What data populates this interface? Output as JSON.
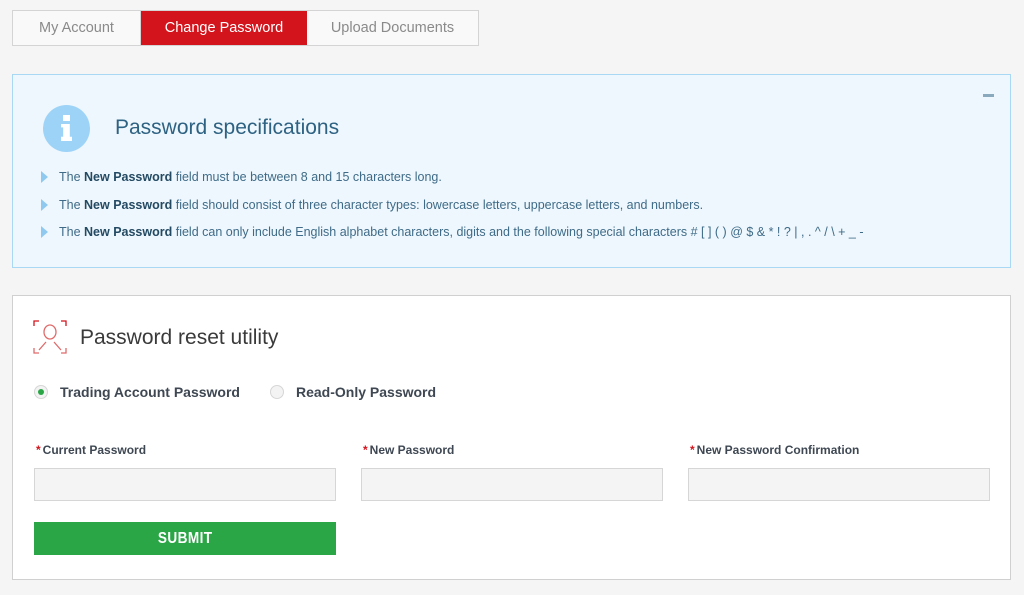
{
  "tabs": [
    {
      "label": "My Account",
      "active": false
    },
    {
      "label": "Change Password",
      "active": true
    },
    {
      "label": "Upload Documents",
      "active": false
    }
  ],
  "spec": {
    "icon": "info-icon",
    "title": "Password specifications",
    "collapse_icon": "minus-icon",
    "items": [
      {
        "prefix": "The ",
        "bold": "New Password",
        "suffix": " field must be between 8 and 15 characters long."
      },
      {
        "prefix": "The ",
        "bold": "New Password",
        "suffix": " field should consist of three character types: lowercase letters, uppercase letters, and numbers."
      },
      {
        "prefix": "The ",
        "bold": "New Password",
        "suffix": " field can only include English alphabet characters, digits and the following special characters # [ ] ( ) @ $ & * ! ? | , . ^ / \\ + _ -"
      }
    ]
  },
  "reset": {
    "icon": "user-scan-icon",
    "title": "Password reset utility",
    "radios": [
      {
        "label": "Trading Account Password",
        "selected": true
      },
      {
        "label": "Read-Only Password",
        "selected": false
      }
    ],
    "fields": [
      {
        "required_mark": "*",
        "label": "Current Password",
        "value": ""
      },
      {
        "required_mark": "*",
        "label": "New Password",
        "value": ""
      },
      {
        "required_mark": "*",
        "label": "New Password Confirmation",
        "value": ""
      }
    ],
    "submit_label": "SUBMIT"
  },
  "colors": {
    "accent_red": "#d3141c",
    "submit_green": "#2aa646",
    "info_blue": "#9dd3f7"
  }
}
